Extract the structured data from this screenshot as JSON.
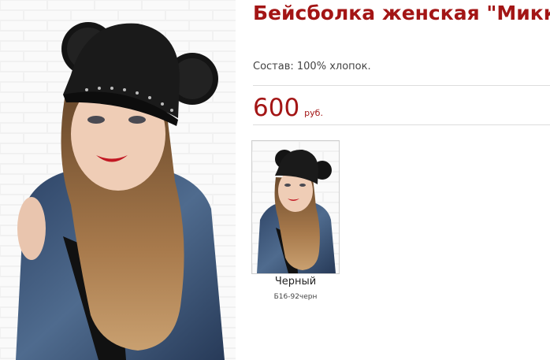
{
  "product": {
    "title": "Бейсболка женская \"Микки\"",
    "composition": "Состав: 100% хлопок.",
    "price": {
      "value": "600",
      "currency": "руб."
    },
    "main_image": {
      "icon": "product-photo-woman-in-mickey-ears-cap"
    },
    "variants": [
      {
        "color_name": "Черный",
        "sku": "Б16-92черн",
        "icon": "variant-thumbnail-photo"
      }
    ]
  },
  "colors": {
    "accent": "#a31515",
    "text": "#444444",
    "divider": "#dddddd"
  }
}
